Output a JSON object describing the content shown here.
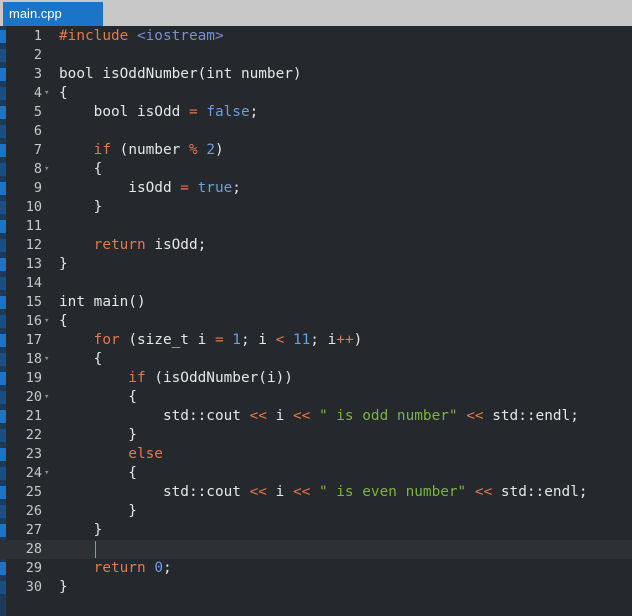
{
  "tab": {
    "label": "main.cpp"
  },
  "editor": {
    "current_line": 28,
    "lines": [
      {
        "n": "1",
        "fold": false,
        "tokens": [
          [
            "pp",
            "#include "
          ],
          [
            "inc",
            "<iostream>"
          ]
        ]
      },
      {
        "n": "2",
        "fold": false,
        "tokens": []
      },
      {
        "n": "3",
        "fold": false,
        "tokens": [
          [
            "ty",
            "bool isOddNumber(int number)"
          ]
        ]
      },
      {
        "n": "4",
        "fold": true,
        "tokens": [
          [
            "ty",
            "{"
          ]
        ]
      },
      {
        "n": "5",
        "fold": false,
        "tokens": [
          [
            "ty",
            "    bool isOdd "
          ],
          [
            "op",
            "="
          ],
          [
            "ty",
            " "
          ],
          [
            "bool",
            "false"
          ],
          [
            "ty",
            ";"
          ]
        ]
      },
      {
        "n": "6",
        "fold": false,
        "tokens": []
      },
      {
        "n": "7",
        "fold": false,
        "tokens": [
          [
            "kw",
            "    if "
          ],
          [
            "ty",
            "(number "
          ],
          [
            "op",
            "%"
          ],
          [
            "ty",
            " "
          ],
          [
            "num",
            "2"
          ],
          [
            "ty",
            ")"
          ]
        ]
      },
      {
        "n": "8",
        "fold": true,
        "tokens": [
          [
            "ty",
            "    {"
          ]
        ]
      },
      {
        "n": "9",
        "fold": false,
        "tokens": [
          [
            "ty",
            "        isOdd "
          ],
          [
            "op",
            "="
          ],
          [
            "ty",
            " "
          ],
          [
            "bool",
            "true"
          ],
          [
            "ty",
            ";"
          ]
        ]
      },
      {
        "n": "10",
        "fold": false,
        "tokens": [
          [
            "ty",
            "    }"
          ]
        ]
      },
      {
        "n": "11",
        "fold": false,
        "tokens": []
      },
      {
        "n": "12",
        "fold": false,
        "tokens": [
          [
            "kw",
            "    return "
          ],
          [
            "ty",
            "isOdd;"
          ]
        ]
      },
      {
        "n": "13",
        "fold": false,
        "tokens": [
          [
            "ty",
            "}"
          ]
        ]
      },
      {
        "n": "14",
        "fold": false,
        "tokens": []
      },
      {
        "n": "15",
        "fold": false,
        "tokens": [
          [
            "ty",
            "int main()"
          ]
        ]
      },
      {
        "n": "16",
        "fold": true,
        "tokens": [
          [
            "ty",
            "{"
          ]
        ]
      },
      {
        "n": "17",
        "fold": false,
        "tokens": [
          [
            "kw",
            "    for "
          ],
          [
            "ty",
            "(size_t i "
          ],
          [
            "op",
            "="
          ],
          [
            "ty",
            " "
          ],
          [
            "num",
            "1"
          ],
          [
            "ty",
            "; i "
          ],
          [
            "op",
            "<"
          ],
          [
            "ty",
            " "
          ],
          [
            "num",
            "11"
          ],
          [
            "ty",
            "; i"
          ],
          [
            "op",
            "++"
          ],
          [
            "ty",
            ")"
          ]
        ]
      },
      {
        "n": "18",
        "fold": true,
        "tokens": [
          [
            "ty",
            "    {"
          ]
        ]
      },
      {
        "n": "19",
        "fold": false,
        "tokens": [
          [
            "kw",
            "        if "
          ],
          [
            "ty",
            "(isOddNumber(i))"
          ]
        ]
      },
      {
        "n": "20",
        "fold": true,
        "tokens": [
          [
            "ty",
            "        {"
          ]
        ]
      },
      {
        "n": "21",
        "fold": false,
        "tokens": [
          [
            "ty",
            "            std::cout "
          ],
          [
            "op",
            "<<"
          ],
          [
            "ty",
            " i "
          ],
          [
            "op",
            "<<"
          ],
          [
            "ty",
            " "
          ],
          [
            "str",
            "\" is odd number\""
          ],
          [
            "ty",
            " "
          ],
          [
            "op",
            "<<"
          ],
          [
            "ty",
            " std::endl;"
          ]
        ]
      },
      {
        "n": "22",
        "fold": false,
        "tokens": [
          [
            "ty",
            "        }"
          ]
        ]
      },
      {
        "n": "23",
        "fold": false,
        "tokens": [
          [
            "kw",
            "        else"
          ]
        ]
      },
      {
        "n": "24",
        "fold": true,
        "tokens": [
          [
            "ty",
            "        {"
          ]
        ]
      },
      {
        "n": "25",
        "fold": false,
        "tokens": [
          [
            "ty",
            "            std::cout "
          ],
          [
            "op",
            "<<"
          ],
          [
            "ty",
            " i "
          ],
          [
            "op",
            "<<"
          ],
          [
            "ty",
            " "
          ],
          [
            "str",
            "\" is even number\""
          ],
          [
            "ty",
            " "
          ],
          [
            "op",
            "<<"
          ],
          [
            "ty",
            " std::endl;"
          ]
        ]
      },
      {
        "n": "26",
        "fold": false,
        "tokens": [
          [
            "ty",
            "        }"
          ]
        ]
      },
      {
        "n": "27",
        "fold": false,
        "tokens": [
          [
            "ty",
            "    }"
          ]
        ]
      },
      {
        "n": "28",
        "fold": false,
        "tokens": []
      },
      {
        "n": "29",
        "fold": false,
        "tokens": [
          [
            "kw",
            "    return "
          ],
          [
            "num",
            "0"
          ],
          [
            "ty",
            ";"
          ]
        ]
      },
      {
        "n": "30",
        "fold": false,
        "tokens": [
          [
            "ty",
            "}"
          ]
        ]
      }
    ]
  }
}
